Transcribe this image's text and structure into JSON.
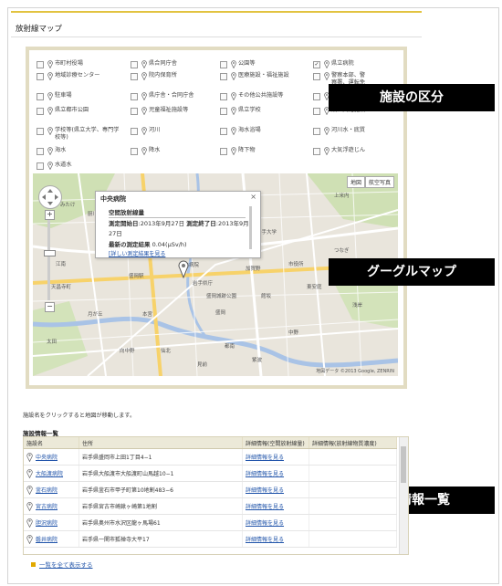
{
  "page": {
    "title": "放射線マップ",
    "hint": "施設名をクリックすると地図が移動します。",
    "list_title": "施設情報一覧",
    "show_all": "一覧を全て表示する"
  },
  "categories": [
    {
      "label": "市町村役場",
      "checked": false
    },
    {
      "label": "県合同庁舎",
      "checked": false
    },
    {
      "label": "公園等",
      "checked": false
    },
    {
      "label": "県立病院",
      "checked": true
    },
    {
      "label": "地域診療センター",
      "checked": false
    },
    {
      "label": "院内保育所",
      "checked": false
    },
    {
      "label": "医療施設・福祉施設",
      "checked": false
    },
    {
      "label": "警察本部、警察署、運転免許試験場",
      "checked": false
    },
    {
      "label": "駐車場",
      "checked": false
    },
    {
      "label": "県庁舎・合同庁舎",
      "checked": false
    },
    {
      "label": "その他公共施設等",
      "checked": false
    },
    {
      "label": "県",
      "checked": false
    },
    {
      "label": "県立都市公園",
      "checked": false
    },
    {
      "label": "児童福祉施設等",
      "checked": false
    },
    {
      "label": "県立学校",
      "checked": false
    },
    {
      "label": "設、文化施設",
      "checked": false
    },
    {
      "label": "学校等(県立大学、専門学校等)",
      "checked": false
    },
    {
      "label": "河川",
      "checked": false
    },
    {
      "label": "海水浴場",
      "checked": false
    },
    {
      "label": "河川水・底質",
      "checked": false
    },
    {
      "label": "海水",
      "checked": false
    },
    {
      "label": "降水",
      "checked": false
    },
    {
      "label": "降下物",
      "checked": false
    },
    {
      "label": "大気浮遊じん",
      "checked": false
    },
    {
      "label": "水道水",
      "checked": false
    }
  ],
  "map": {
    "type_buttons": [
      "地図",
      "航空写真"
    ],
    "zoom_plus": "+",
    "zoom_minus": "−",
    "copyright": "地図データ ©2013 Google, ZENRIN",
    "labels": [
      "中央病院",
      "岩手県庁",
      "盛岡駅",
      "山岸",
      "上田",
      "加賀野",
      "本宮",
      "仙北",
      "青山",
      "厨川",
      "みたけ",
      "向中野",
      "見前",
      "江南",
      "北山",
      "天昌寺町",
      "館坂",
      "中野",
      "東安庭",
      "上米内",
      "つなぎ",
      "紫波",
      "盛岡",
      "月が丘",
      "岩手大学",
      "市役所",
      "盛岡城跡公園",
      "太田",
      "都南",
      "浅岸"
    ]
  },
  "infowindow": {
    "name": "中央病院",
    "section": "空間放射線量",
    "start_label": "測定開始日",
    "start_value": "2013年9月27日",
    "end_label": "測定終了日",
    "end_value": "2013年9月27日",
    "result_label": "最新の測定結果",
    "result_value": "0.04(μSv/h)",
    "link": "[詳しい測定結果を見る",
    "close": "×"
  },
  "callouts": {
    "categories": "施設の区分",
    "map": "グーグルマップ",
    "list": "施設情報一覧"
  },
  "table": {
    "headers": [
      "施設名",
      "住所",
      "詳細情報(空間放射線量)",
      "詳細情報(放射線物質濃度)"
    ],
    "rows": [
      {
        "name": "中央病院",
        "address": "岩手県盛岡市上田1丁目4−1",
        "detail1": "詳細情報を見る",
        "detail2": ""
      },
      {
        "name": "大船渡病院",
        "address": "岩手県大船渡市大船渡町山馬越10−1",
        "detail1": "詳細情報を見る",
        "detail2": ""
      },
      {
        "name": "釜石病院",
        "address": "岩手県釜石市甲子町第10地割483−6",
        "detail1": "詳細情報を見る",
        "detail2": ""
      },
      {
        "name": "宮古病院",
        "address": "岩手県宮古市崎鍬ヶ崎第1地割",
        "detail1": "詳細情報を見る",
        "detail2": ""
      },
      {
        "name": "胆沢病院",
        "address": "岩手県奥州市水沢区龍ヶ馬場61",
        "detail1": "詳細情報を見る",
        "detail2": ""
      },
      {
        "name": "磐井病院",
        "address": "岩手県一関市狐禅寺大平17",
        "detail1": "詳細情報を見る",
        "detail2": ""
      }
    ]
  },
  "colors": {
    "accent": "#e2c341",
    "panel_border": "#e2dcc2",
    "link": "#2255aa",
    "callout_bg": "#000000"
  }
}
